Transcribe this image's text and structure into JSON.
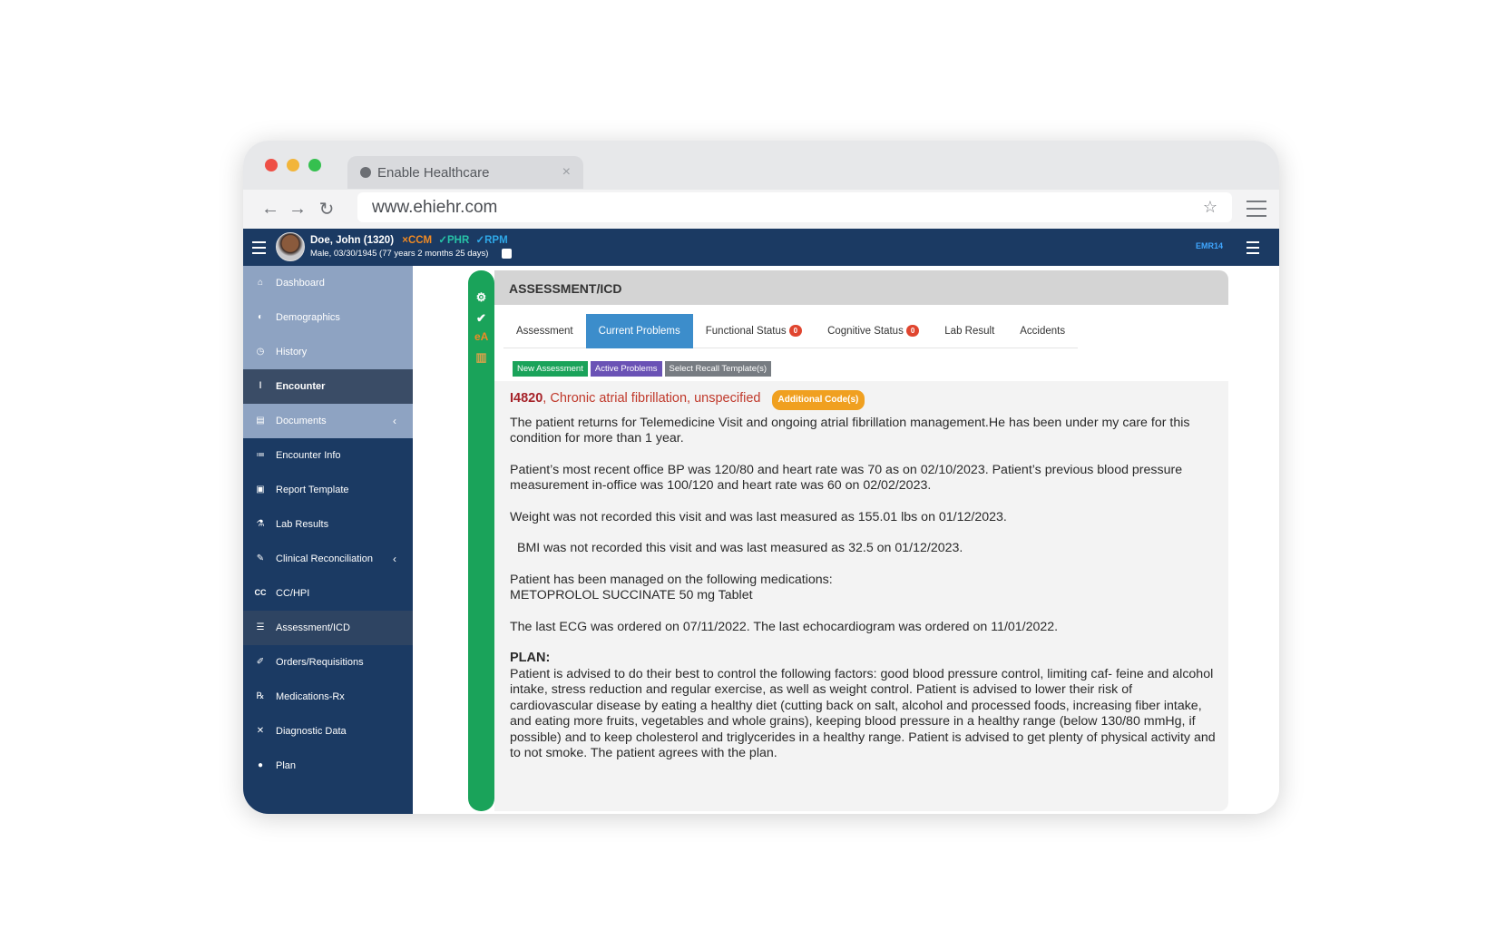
{
  "browser": {
    "tab_title": "Enable Healthcare",
    "url": "www.ehiehr.com"
  },
  "patient": {
    "name": "Doe, John (1320)",
    "tags": [
      "×CCM",
      "✓PHR",
      "✓RPM"
    ],
    "info": "Male, 03/30/1945 (77 years 2 months 25 days)"
  },
  "header": {
    "emr_label": "EMR14"
  },
  "sidebar": {
    "items": [
      {
        "label": "Dashboard"
      },
      {
        "label": "Demographics"
      },
      {
        "label": "History"
      },
      {
        "label": "Encounter"
      },
      {
        "label": "Documents"
      },
      {
        "label": "Encounter Info"
      },
      {
        "label": "Report Template"
      },
      {
        "label": "Lab Results"
      },
      {
        "label": "Clinical Reconciliation"
      },
      {
        "label": "CC/HPI"
      },
      {
        "label": "Assessment/ICD"
      },
      {
        "label": "Orders/Requisitions"
      },
      {
        "label": "Medications-Rx"
      },
      {
        "label": "Diagnostic Data"
      },
      {
        "label": "Plan"
      }
    ]
  },
  "panel": {
    "title": "ASSESSMENT/ICD",
    "tabs": [
      {
        "label": "Assessment"
      },
      {
        "label": "Current Problems"
      },
      {
        "label": "Functional Status",
        "badge": "0"
      },
      {
        "label": "Cognitive Status",
        "badge": "0"
      },
      {
        "label": "Lab Result"
      },
      {
        "label": "Accidents"
      }
    ],
    "buttons": {
      "new": "New Assessment",
      "active": "Active Problems",
      "recall": "Select Recall Template(s)"
    },
    "icd_code": "I4820",
    "icd_desc": ", Chronic atrial fibrillation, unspecified",
    "additional": "Additional Code(s)",
    "paragraphs": [
      "The patient returns for Telemedicine Visit and ongoing atrial fibrillation management.He has been under my care for this condition for more than 1 year.",
      "Patient’s most recent office BP was 120/80  and heart rate was 70 as on 02/10/2023. Patient’s previous blood pressure measurement in-office was 100/120 and heart rate was 60 on 02/02/2023.",
      "Weight was not recorded this visit  and was last measured as 155.01 lbs on 01/12/2023.",
      "BMI was not recorded this visit and was last measured as 32.5 on 01/12/2023.",
      "Patient has been managed on the following medications:",
      "METOPROLOL SUCCINATE 50 mg Tablet",
      "The last ECG was ordered on 07/11/2022. The last echocardiogram was ordered on 11/01/2022."
    ],
    "plan_heading": "PLAN:",
    "plan_text": "Patient is advised to do their best to control the following factors: good blood pressure control, limiting caf- feine and alcohol intake, stress reduction and regular exercise, as well as weight control. Patient is advised to lower their risk of cardiovascular disease by eating a healthy diet (cutting back on salt, alcohol and processed foods, increasing fiber intake, and eating more fruits, vegetables and whole grains), keeping blood pressure in a healthy range (below 130/80 mmHg, if possible) and to keep cholesterol and triglycerides in a healthy range. Patient is advised to get plenty of physical activity and to not smoke. The patient agrees with the plan."
  }
}
